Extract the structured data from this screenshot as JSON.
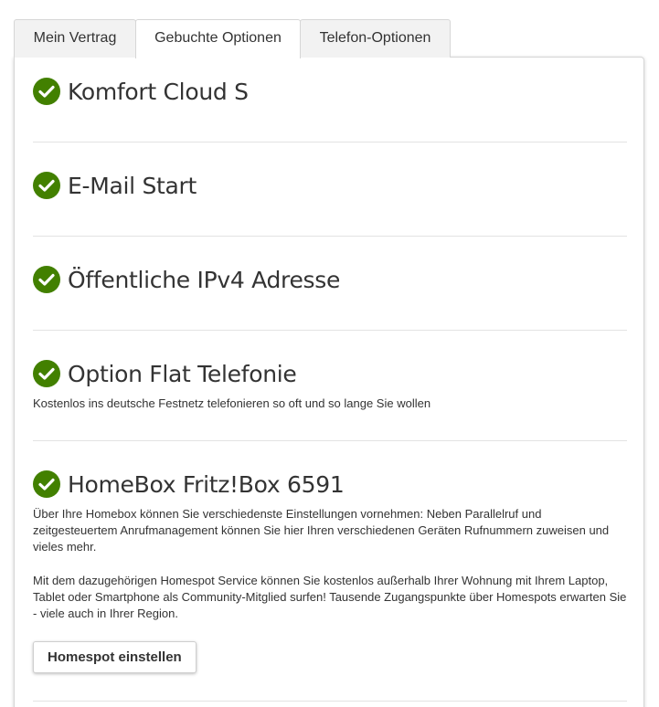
{
  "tabs": [
    {
      "label": "Mein Vertrag",
      "active": false
    },
    {
      "label": "Gebuchte Optionen",
      "active": true
    },
    {
      "label": "Telefon-Optionen",
      "active": false
    }
  ],
  "options": [
    {
      "title": "Komfort Cloud S",
      "icon": "checkmark-circle-icon"
    },
    {
      "title": "E-Mail Start",
      "icon": "checkmark-circle-icon"
    },
    {
      "title": "Öffentliche IPv4 Adresse",
      "icon": "checkmark-circle-icon"
    },
    {
      "title": "Option Flat Telefonie",
      "icon": "checkmark-circle-icon",
      "description": "Kostenlos ins deutsche Festnetz telefonieren so oft und so lange Sie wollen"
    },
    {
      "title": "HomeBox Fritz!Box 6591",
      "icon": "checkmark-circle-icon",
      "description": "Über Ihre Homebox können Sie verschiedenste Einstellungen vornehmen: Neben Parallelruf und zeitgesteuertem Anrufmanagement können Sie hier Ihren verschiedenen Geräten Rufnummern zuweisen und vieles mehr.",
      "description2": "Mit dem dazugehörigen Homespot Service können Sie kostenlos außerhalb Ihrer Wohnung mit Ihrem Laptop, Tablet oder Smartphone als Community-Mitglied surfen! Tausende Zugangspunkte über Homespots erwarten Sie - viele auch in Ihrer Region.",
      "button_label": "Homespot einstellen"
    }
  ],
  "colors": {
    "check": "#428000",
    "text": "#333333",
    "divider": "#e3e3e3"
  }
}
